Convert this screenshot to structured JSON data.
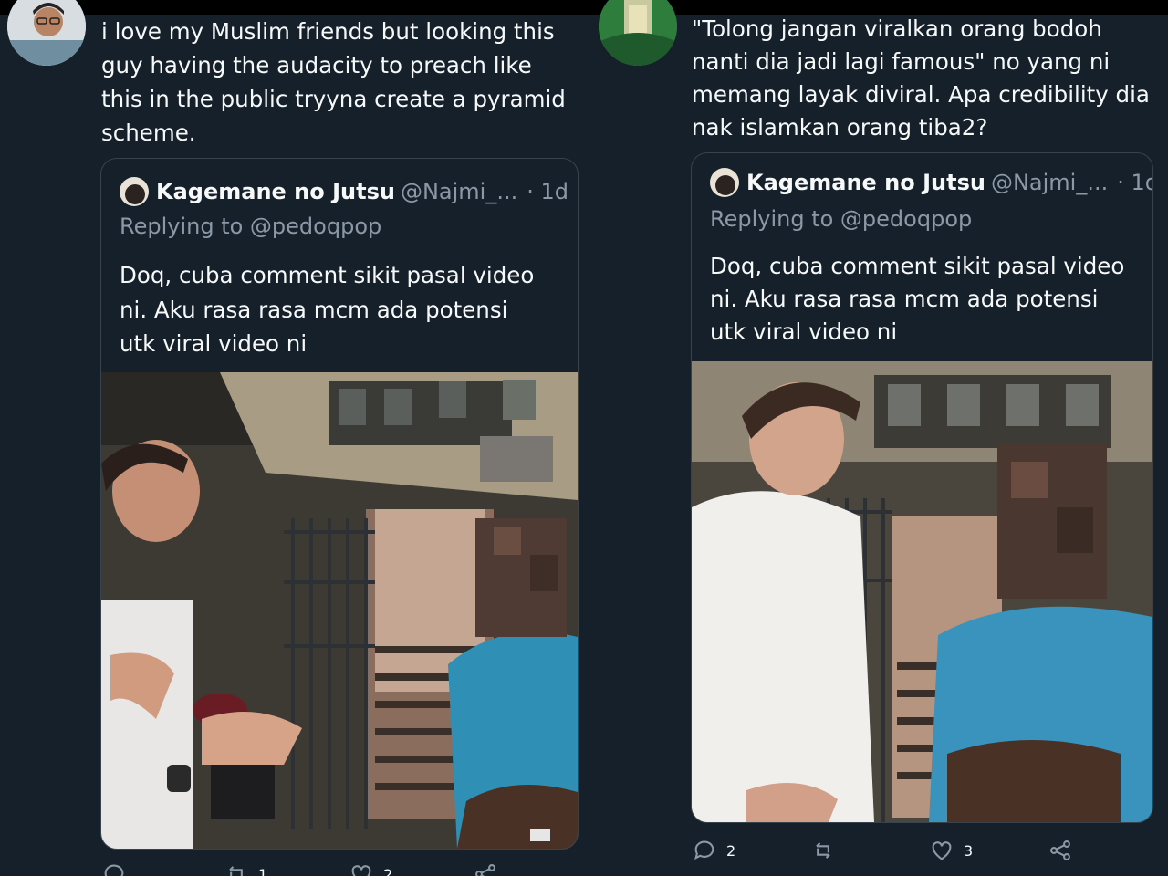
{
  "left_tweet": {
    "text": "i love my Muslim friends but looking this\nguy having the audacity to preach like\nthis in the public tryyna create a pyramid\nscheme.",
    "quoted": {
      "name": "Kagemane no Jutsu",
      "handle": "@Najmi_...",
      "time": "· 1d",
      "replying": "Replying to @pedoqpop",
      "text": "Doq, cuba comment sikit pasal video\nni. Aku rasa rasa mcm ada potensi\nutk viral video ni"
    },
    "actions": {
      "reply_count": "",
      "retweet_count": "1",
      "like_count": "2",
      "icons": [
        "reply-icon",
        "retweet-icon",
        "like-icon",
        "share-icon"
      ]
    }
  },
  "right_tweet": {
    "text": "\"Tolong jangan viralkan orang bodoh\nnanti dia jadi lagi famous\" no yang ni\nmemang layak diviral. Apa credibility dia\nnak islamkan orang tiba2?",
    "quoted": {
      "name": "Kagemane no Jutsu",
      "handle": "@Najmi_...",
      "time": "· 1d",
      "replying": "Replying to @pedoqpop",
      "text": "Doq, cuba comment sikit pasal video\nni. Aku rasa rasa mcm ada potensi\nutk viral video ni"
    },
    "actions": {
      "reply_count": "2",
      "retweet_count": "",
      "like_count": "3",
      "icons": [
        "reply-icon",
        "retweet-icon",
        "like-icon",
        "share-icon"
      ]
    }
  },
  "colors": {
    "background": "#15202b",
    "border": "#38444d",
    "text": "#f7f9f9",
    "muted": "#8b98a5"
  }
}
